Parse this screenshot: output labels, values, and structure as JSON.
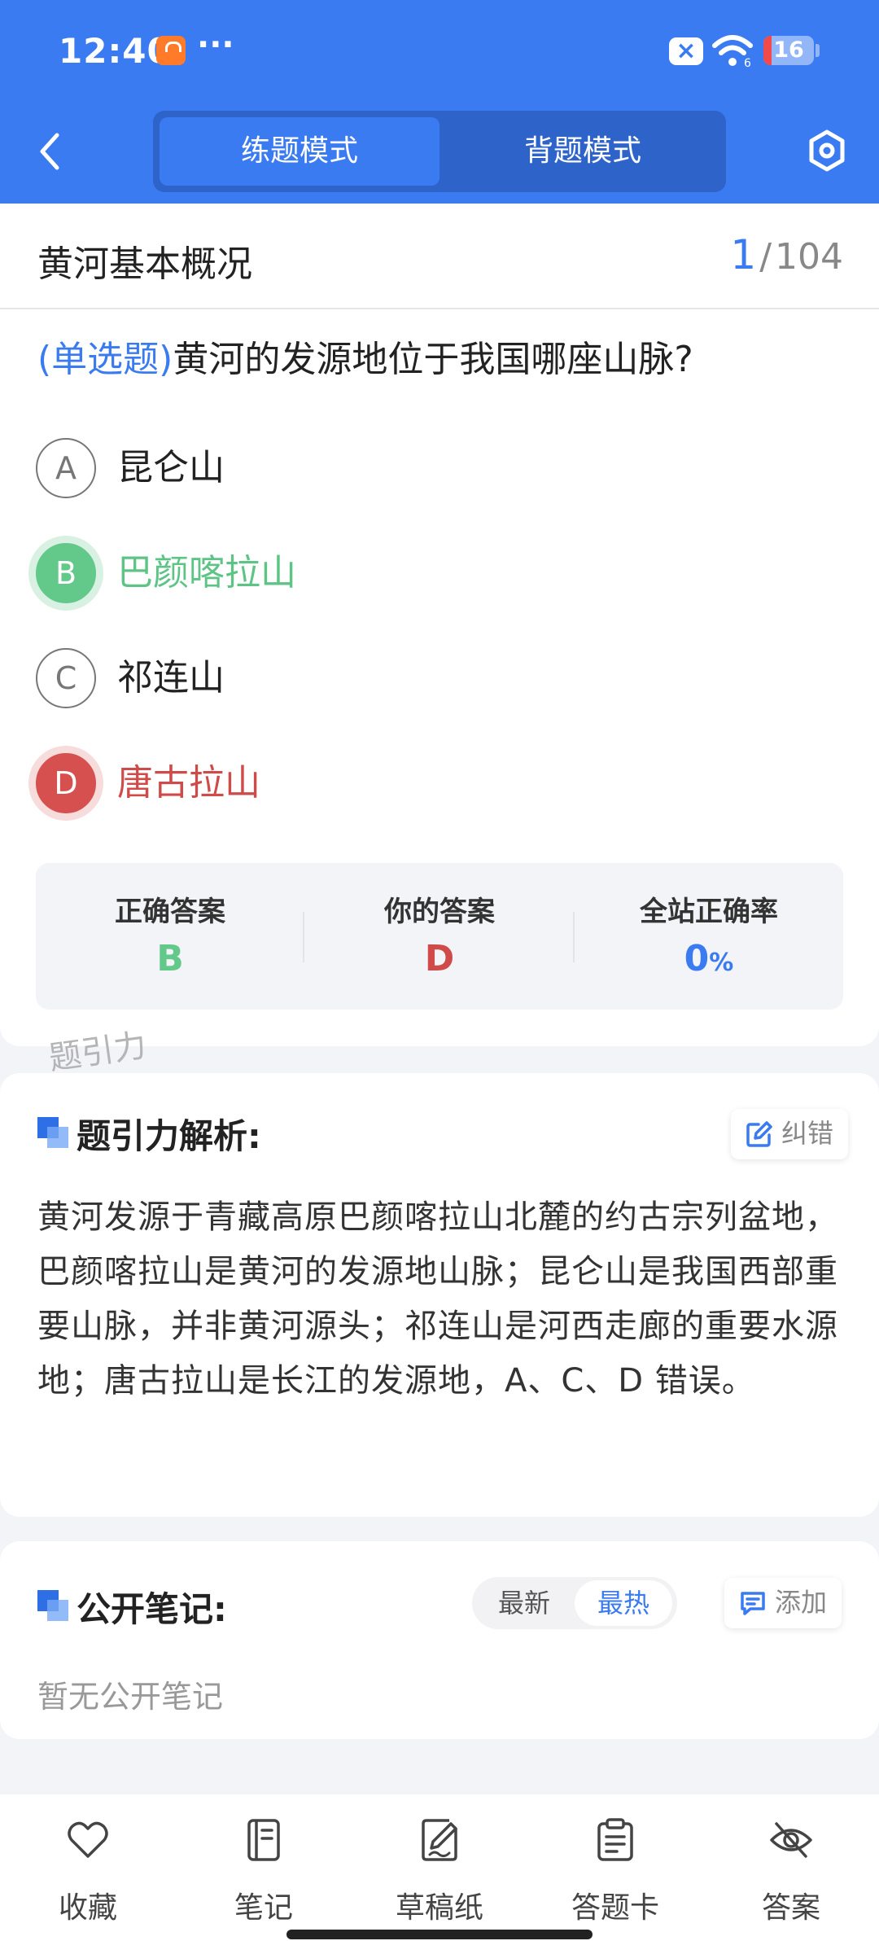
{
  "status_bar": {
    "time": "12:40",
    "more": "···",
    "battery_level": "16",
    "battery_fraction": 0.16,
    "icons": [
      "shopping-app-icon",
      "close-x-icon",
      "wifi-icon",
      "battery-icon"
    ]
  },
  "header": {
    "back_icon": "chevron-left-icon",
    "modes": [
      {
        "label": "练题模式",
        "active": true
      },
      {
        "label": "背题模式",
        "active": false
      }
    ],
    "settings_icon": "hexagon-settings-icon"
  },
  "question": {
    "chapter": "黄河基本概况",
    "current": "1",
    "sep": "/",
    "total": "104",
    "type_label": "(单选题)",
    "text": "黄河的发源地位于我国哪座山脉?",
    "options": [
      {
        "letter": "A",
        "text": "昆仑山",
        "state": "normal"
      },
      {
        "letter": "B",
        "text": "巴颜喀拉山",
        "state": "correct"
      },
      {
        "letter": "C",
        "text": "祁连山",
        "state": "normal"
      },
      {
        "letter": "D",
        "text": "唐古拉山",
        "state": "wrong"
      }
    ],
    "result": {
      "correct_label": "正确答案",
      "correct_value": "B",
      "yours_label": "你的答案",
      "yours_value": "D",
      "rate_label": "全站正确率",
      "rate_value": "0",
      "rate_unit": "%"
    },
    "watermark": "题引力"
  },
  "analysis": {
    "title": "题引力解析:",
    "report_label": "纠错",
    "text": "黄河发源于青藏高原巴颜喀拉山北麓的约古宗列盆地，巴颜喀拉山是黄河的发源地山脉；昆仑山是我国西部重要山脉，并非黄河源头；祁连山是河西走廊的重要水源地；唐古拉山是长江的发源地，A、C、D 错误。"
  },
  "notes": {
    "title": "公开笔记:",
    "sort": [
      {
        "label": "最新",
        "active": false
      },
      {
        "label": "最热",
        "active": true
      }
    ],
    "add_label": "添加",
    "empty": "暂无公开笔记"
  },
  "bottom_nav": [
    {
      "label": "收藏",
      "icon": "heart-icon"
    },
    {
      "label": "笔记",
      "icon": "notebook-icon"
    },
    {
      "label": "草稿纸",
      "icon": "draft-paper-icon"
    },
    {
      "label": "答题卡",
      "icon": "answer-sheet-icon"
    },
    {
      "label": "答案",
      "icon": "eye-off-icon"
    }
  ],
  "colors": {
    "primary": "#3a7bf1",
    "correct": "#62c98a",
    "wrong": "#d5504f"
  }
}
